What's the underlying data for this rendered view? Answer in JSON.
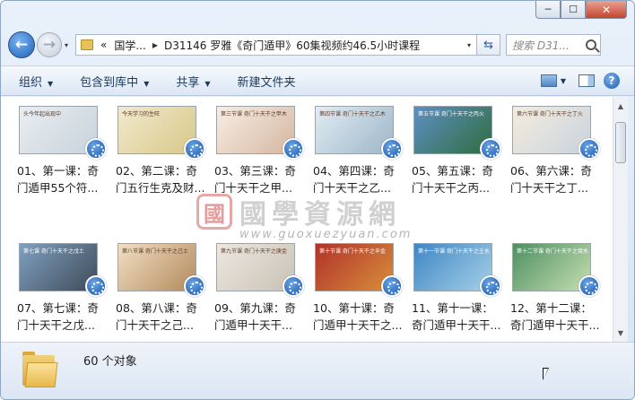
{
  "window": {
    "caption": {
      "minimize": "─",
      "maximize": "☐",
      "close": "✕"
    }
  },
  "nav": {
    "back": "←",
    "forward": "→",
    "history": "▾",
    "path_overflow": "«",
    "path_segments": [
      "国学...",
      "D31146 罗雅《奇门遁甲》60集视频约46.5小时课程"
    ],
    "path_dropdown": "▾",
    "refresh": "⇆",
    "search_placeholder": "搜索 D31..."
  },
  "toolbar": {
    "items": [
      "组织",
      "包含到库中",
      "共享",
      "新建文件夹"
    ],
    "dropdown_arrow": "▼",
    "help": "?"
  },
  "files": [
    {
      "line1": "01、第一课：奇",
      "line2": "门遁甲55个符...",
      "thumb_title": "头今年起出现中",
      "colors": [
        "#e9eef2",
        "#c8d2db"
      ]
    },
    {
      "line1": "02、第二课：奇",
      "line2": "门五行生克及财...",
      "thumb_title": "今天学习的生旺",
      "colors": [
        "#f1e9cd",
        "#d8c889"
      ]
    },
    {
      "line1": "03、第三课：奇",
      "line2": "门十天干之甲...",
      "thumb_title": "第三节课 奇门十天干之甲木",
      "colors": [
        "#f6eee6",
        "#d6b79f"
      ]
    },
    {
      "line1": "04、第四课：奇",
      "line2": "门十天干之乙...",
      "thumb_title": "第四节课 奇门十天干之乙木",
      "colors": [
        "#e3ecf2",
        "#9bb6c9"
      ]
    },
    {
      "line1": "05、第五课：奇",
      "line2": "门十天干之丙...",
      "thumb_title": "第五节课 奇门十天干之丙火",
      "colors": [
        "#5e8fc2",
        "#2f6d3f"
      ]
    },
    {
      "line1": "06、第六课：奇",
      "line2": "门十天干之丁...",
      "thumb_title": "第六节课 奇门十天干之丁火",
      "colors": [
        "#f4ecdf",
        "#c9d3dc"
      ]
    },
    {
      "line1": "07、第七课：奇",
      "line2": "门十天干之戊...",
      "thumb_title": "第七课 奇门十天干之戊土",
      "colors": [
        "#7fa0c0",
        "#3f4b58"
      ]
    },
    {
      "line1": "08、第八课：奇",
      "line2": "门十天干之己...",
      "thumb_title": "第八节课 奇门十天干之己土",
      "colors": [
        "#f1dfc4",
        "#b38a5c"
      ]
    },
    {
      "line1": "09、第九课：奇",
      "line2": "门遁甲十天干...",
      "thumb_title": "第九节课 奇门十天干之庚金",
      "colors": [
        "#ece8e1",
        "#c9c1b4"
      ]
    },
    {
      "line1": "10、第十课：奇",
      "line2": "门遁甲十天干之...",
      "thumb_title": "第十节课 奇门十天干之辛金",
      "colors": [
        "#b1322a",
        "#d88e3a"
      ]
    },
    {
      "line1": "11、第十一课：",
      "line2": "奇门遁甲十天干...",
      "thumb_title": "第十一节课 奇门十天干之壬水",
      "colors": [
        "#3f86c4",
        "#a6d0e8"
      ]
    },
    {
      "line1": "12、第十二课：",
      "line2": "奇门遁甲十天干...",
      "thumb_title": "第十二节课 奇门十天干之癸水",
      "colors": [
        "#4e8f61",
        "#c6dfb2"
      ]
    }
  ],
  "watermark": {
    "seal": "國",
    "text": "國學資源網",
    "url": "www.guoxuezyuan.com"
  },
  "scrollbar": {
    "up": "▲",
    "down": "▼"
  },
  "status": {
    "count_text": "60 个对象"
  }
}
